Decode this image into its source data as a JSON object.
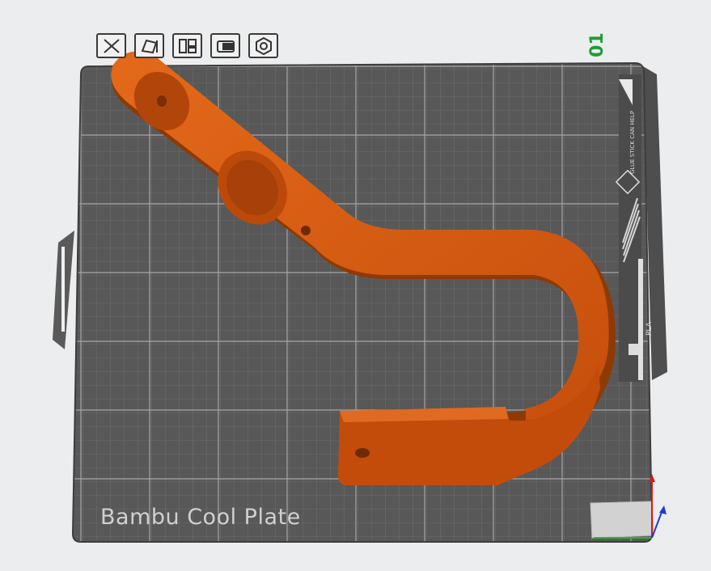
{
  "toolbar": {
    "buttons": [
      {
        "name": "auto-orient-button",
        "icon": "auto-orient-icon"
      },
      {
        "name": "lay-on-face-button",
        "icon": "lay-on-face-icon"
      },
      {
        "name": "arrange-button",
        "icon": "arrange-icon"
      },
      {
        "name": "lock-plate-button",
        "icon": "lock-icon"
      },
      {
        "name": "plate-settings-button",
        "icon": "plate-settings-icon"
      }
    ]
  },
  "plate": {
    "index": "01",
    "name": "Bambu Cool Plate",
    "sticker_text": "GLUE STICK CAN HELP",
    "material_text": "PLA"
  },
  "colors": {
    "background": "#ecedee",
    "plate": "#585858",
    "grid": "#8e8e8e",
    "part": "#d35a12",
    "part_dark": "#8e3a05",
    "plate_index": "#1f9c3a",
    "axis_x": "#22b82a",
    "axis_y": "#1a3cd8",
    "axis_z": "#d41a1a"
  }
}
